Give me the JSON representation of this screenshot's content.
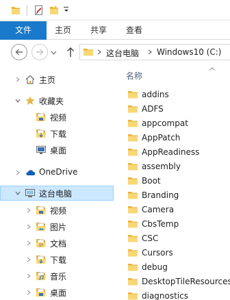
{
  "ribbon": {
    "tabs": [
      "文件",
      "主页",
      "共享",
      "查看"
    ]
  },
  "address": {
    "segments": [
      "这台电脑",
      "Windows10 (C:)"
    ]
  },
  "nav_pane": {
    "home": "主页",
    "favorites": "收藏夹",
    "fav_items": [
      "视频",
      "下载",
      "桌面"
    ],
    "onedrive": "OneDrive",
    "this_pc": "这台电脑",
    "pc_items": [
      "视频",
      "图片",
      "文档",
      "下载",
      "音乐",
      "桌面"
    ]
  },
  "content": {
    "column_header": "名称",
    "files": [
      "addins",
      "ADFS",
      "appcompat",
      "AppPatch",
      "AppReadiness",
      "assembly",
      "Boot",
      "Branding",
      "Camera",
      "CbsTemp",
      "CSC",
      "Cursors",
      "debug",
      "DesktopTileResources",
      "diagnostics"
    ]
  },
  "colors": {
    "accent": "#1979ca",
    "selection": "#cce8ff",
    "folder": "#f5c745"
  }
}
